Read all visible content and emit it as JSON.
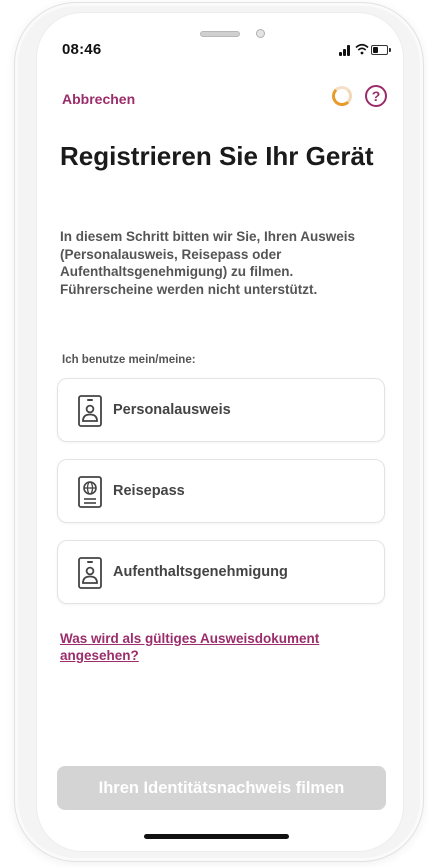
{
  "status_bar": {
    "time": "08:46",
    "icons": [
      "signal-icon",
      "wifi-icon",
      "battery-icon"
    ]
  },
  "nav": {
    "cancel_label": "Abbrechen",
    "help_glyph": "?",
    "icons": [
      "loading-spinner-icon",
      "help-circle-icon"
    ]
  },
  "page": {
    "title": "Registrieren Sie Ihr Gerät",
    "intro": "In diesem Schritt bitten wir Sie, Ihren Ausweis (Personalausweis, Reisepass oder Aufenthaltsgenehmigung) zu filmen. Führerscheine werden nicht unterstützt.",
    "uses_label": "Ich benutze mein/meine:"
  },
  "options": [
    {
      "label": "Personalausweis",
      "icon": "id-card-icon"
    },
    {
      "label": "Reisepass",
      "icon": "passport-icon"
    },
    {
      "label": "Aufenthaltsgenehmigung",
      "icon": "id-card-icon"
    }
  ],
  "faq_link": "Was wird als gültiges Ausweisdokument angesehen?",
  "cta_label": "Ihren Identitätsnachweis filmen",
  "colors": {
    "accent": "#9b2d6b",
    "spinner": "#e89a2a",
    "cta_disabled": "#d4d4d4",
    "text_primary": "#1a1a1a",
    "text_secondary": "#555555"
  }
}
